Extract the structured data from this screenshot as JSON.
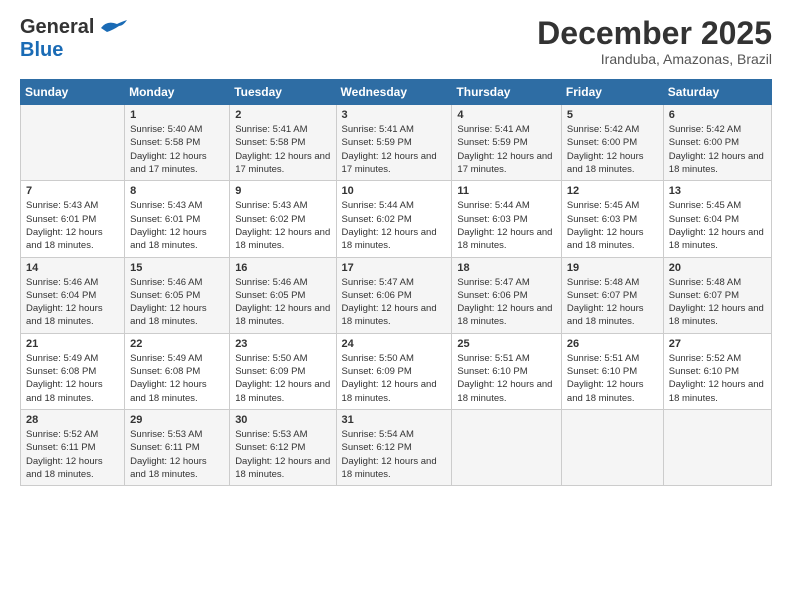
{
  "logo": {
    "line1": "General",
    "line2": "Blue"
  },
  "title": "December 2025",
  "location": "Iranduba, Amazonas, Brazil",
  "days_header": [
    "Sunday",
    "Monday",
    "Tuesday",
    "Wednesday",
    "Thursday",
    "Friday",
    "Saturday"
  ],
  "weeks": [
    [
      {
        "day": "",
        "sunrise": "",
        "sunset": "",
        "daylight": ""
      },
      {
        "day": "1",
        "sunrise": "Sunrise: 5:40 AM",
        "sunset": "Sunset: 5:58 PM",
        "daylight": "Daylight: 12 hours and 17 minutes."
      },
      {
        "day": "2",
        "sunrise": "Sunrise: 5:41 AM",
        "sunset": "Sunset: 5:58 PM",
        "daylight": "Daylight: 12 hours and 17 minutes."
      },
      {
        "day": "3",
        "sunrise": "Sunrise: 5:41 AM",
        "sunset": "Sunset: 5:59 PM",
        "daylight": "Daylight: 12 hours and 17 minutes."
      },
      {
        "day": "4",
        "sunrise": "Sunrise: 5:41 AM",
        "sunset": "Sunset: 5:59 PM",
        "daylight": "Daylight: 12 hours and 17 minutes."
      },
      {
        "day": "5",
        "sunrise": "Sunrise: 5:42 AM",
        "sunset": "Sunset: 6:00 PM",
        "daylight": "Daylight: 12 hours and 18 minutes."
      },
      {
        "day": "6",
        "sunrise": "Sunrise: 5:42 AM",
        "sunset": "Sunset: 6:00 PM",
        "daylight": "Daylight: 12 hours and 18 minutes."
      }
    ],
    [
      {
        "day": "7",
        "sunrise": "Sunrise: 5:43 AM",
        "sunset": "Sunset: 6:01 PM",
        "daylight": "Daylight: 12 hours and 18 minutes."
      },
      {
        "day": "8",
        "sunrise": "Sunrise: 5:43 AM",
        "sunset": "Sunset: 6:01 PM",
        "daylight": "Daylight: 12 hours and 18 minutes."
      },
      {
        "day": "9",
        "sunrise": "Sunrise: 5:43 AM",
        "sunset": "Sunset: 6:02 PM",
        "daylight": "Daylight: 12 hours and 18 minutes."
      },
      {
        "day": "10",
        "sunrise": "Sunrise: 5:44 AM",
        "sunset": "Sunset: 6:02 PM",
        "daylight": "Daylight: 12 hours and 18 minutes."
      },
      {
        "day": "11",
        "sunrise": "Sunrise: 5:44 AM",
        "sunset": "Sunset: 6:03 PM",
        "daylight": "Daylight: 12 hours and 18 minutes."
      },
      {
        "day": "12",
        "sunrise": "Sunrise: 5:45 AM",
        "sunset": "Sunset: 6:03 PM",
        "daylight": "Daylight: 12 hours and 18 minutes."
      },
      {
        "day": "13",
        "sunrise": "Sunrise: 5:45 AM",
        "sunset": "Sunset: 6:04 PM",
        "daylight": "Daylight: 12 hours and 18 minutes."
      }
    ],
    [
      {
        "day": "14",
        "sunrise": "Sunrise: 5:46 AM",
        "sunset": "Sunset: 6:04 PM",
        "daylight": "Daylight: 12 hours and 18 minutes."
      },
      {
        "day": "15",
        "sunrise": "Sunrise: 5:46 AM",
        "sunset": "Sunset: 6:05 PM",
        "daylight": "Daylight: 12 hours and 18 minutes."
      },
      {
        "day": "16",
        "sunrise": "Sunrise: 5:46 AM",
        "sunset": "Sunset: 6:05 PM",
        "daylight": "Daylight: 12 hours and 18 minutes."
      },
      {
        "day": "17",
        "sunrise": "Sunrise: 5:47 AM",
        "sunset": "Sunset: 6:06 PM",
        "daylight": "Daylight: 12 hours and 18 minutes."
      },
      {
        "day": "18",
        "sunrise": "Sunrise: 5:47 AM",
        "sunset": "Sunset: 6:06 PM",
        "daylight": "Daylight: 12 hours and 18 minutes."
      },
      {
        "day": "19",
        "sunrise": "Sunrise: 5:48 AM",
        "sunset": "Sunset: 6:07 PM",
        "daylight": "Daylight: 12 hours and 18 minutes."
      },
      {
        "day": "20",
        "sunrise": "Sunrise: 5:48 AM",
        "sunset": "Sunset: 6:07 PM",
        "daylight": "Daylight: 12 hours and 18 minutes."
      }
    ],
    [
      {
        "day": "21",
        "sunrise": "Sunrise: 5:49 AM",
        "sunset": "Sunset: 6:08 PM",
        "daylight": "Daylight: 12 hours and 18 minutes."
      },
      {
        "day": "22",
        "sunrise": "Sunrise: 5:49 AM",
        "sunset": "Sunset: 6:08 PM",
        "daylight": "Daylight: 12 hours and 18 minutes."
      },
      {
        "day": "23",
        "sunrise": "Sunrise: 5:50 AM",
        "sunset": "Sunset: 6:09 PM",
        "daylight": "Daylight: 12 hours and 18 minutes."
      },
      {
        "day": "24",
        "sunrise": "Sunrise: 5:50 AM",
        "sunset": "Sunset: 6:09 PM",
        "daylight": "Daylight: 12 hours and 18 minutes."
      },
      {
        "day": "25",
        "sunrise": "Sunrise: 5:51 AM",
        "sunset": "Sunset: 6:10 PM",
        "daylight": "Daylight: 12 hours and 18 minutes."
      },
      {
        "day": "26",
        "sunrise": "Sunrise: 5:51 AM",
        "sunset": "Sunset: 6:10 PM",
        "daylight": "Daylight: 12 hours and 18 minutes."
      },
      {
        "day": "27",
        "sunrise": "Sunrise: 5:52 AM",
        "sunset": "Sunset: 6:10 PM",
        "daylight": "Daylight: 12 hours and 18 minutes."
      }
    ],
    [
      {
        "day": "28",
        "sunrise": "Sunrise: 5:52 AM",
        "sunset": "Sunset: 6:11 PM",
        "daylight": "Daylight: 12 hours and 18 minutes."
      },
      {
        "day": "29",
        "sunrise": "Sunrise: 5:53 AM",
        "sunset": "Sunset: 6:11 PM",
        "daylight": "Daylight: 12 hours and 18 minutes."
      },
      {
        "day": "30",
        "sunrise": "Sunrise: 5:53 AM",
        "sunset": "Sunset: 6:12 PM",
        "daylight": "Daylight: 12 hours and 18 minutes."
      },
      {
        "day": "31",
        "sunrise": "Sunrise: 5:54 AM",
        "sunset": "Sunset: 6:12 PM",
        "daylight": "Daylight: 12 hours and 18 minutes."
      },
      {
        "day": "",
        "sunrise": "",
        "sunset": "",
        "daylight": ""
      },
      {
        "day": "",
        "sunrise": "",
        "sunset": "",
        "daylight": ""
      },
      {
        "day": "",
        "sunrise": "",
        "sunset": "",
        "daylight": ""
      }
    ]
  ]
}
